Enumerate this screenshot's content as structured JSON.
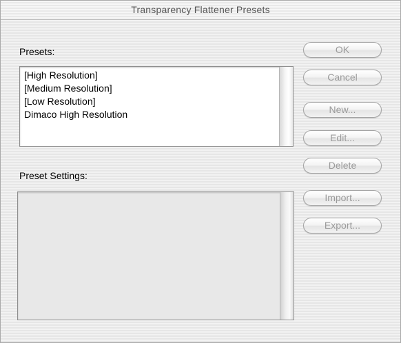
{
  "window": {
    "title": "Transparency Flattener Presets"
  },
  "presets": {
    "label": "Presets:",
    "items": [
      "[High Resolution]",
      "[Medium Resolution]",
      "[Low Resolution]",
      "Dimaco High Resolution"
    ]
  },
  "preset_settings": {
    "label": "Preset Settings:"
  },
  "buttons": {
    "ok": "OK",
    "cancel": "Cancel",
    "new": "New...",
    "edit": "Edit...",
    "delete": "Delete",
    "import": "Import...",
    "export": "Export..."
  },
  "colors": {
    "disabled_text": "#9a9a9a",
    "window_background": "#ececec"
  }
}
